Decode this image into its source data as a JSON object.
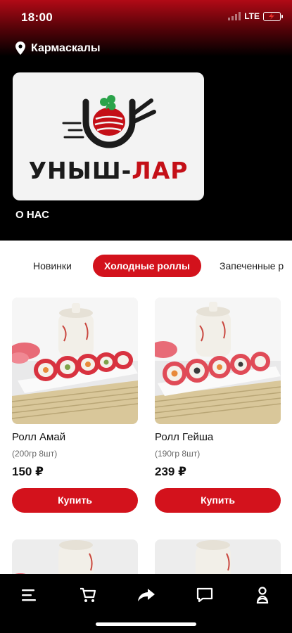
{
  "status_bar": {
    "time": "18:00",
    "network": "LTE"
  },
  "header": {
    "location": "Кармаскалы",
    "logo": {
      "name_part1": "УНЫШ-",
      "name_part2": "ЛАР",
      "alt": "Уныш-Лар logo"
    },
    "about_link": "О НАС"
  },
  "categories": {
    "tabs": [
      {
        "label": "Новинки",
        "active": false
      },
      {
        "label": "Холодные роллы",
        "active": true
      },
      {
        "label": "Запеченные р",
        "active": false
      }
    ]
  },
  "products": [
    {
      "name": "Ролл Амай",
      "weight": "(200гр 8шт)",
      "price": "150 ₽",
      "buy_label": "Купить"
    },
    {
      "name": "Ролл Гейша",
      "weight": "(190гр 8шт)",
      "price": "239 ₽",
      "buy_label": "Купить"
    }
  ],
  "bottom_nav": {
    "items": [
      {
        "icon": "menu-icon"
      },
      {
        "icon": "cart-icon"
      },
      {
        "icon": "share-icon"
      },
      {
        "icon": "chat-icon"
      },
      {
        "icon": "profile-icon"
      }
    ]
  },
  "colors": {
    "accent": "#d3121c",
    "header_bg": "#000000",
    "nav_bg": "#000000"
  }
}
